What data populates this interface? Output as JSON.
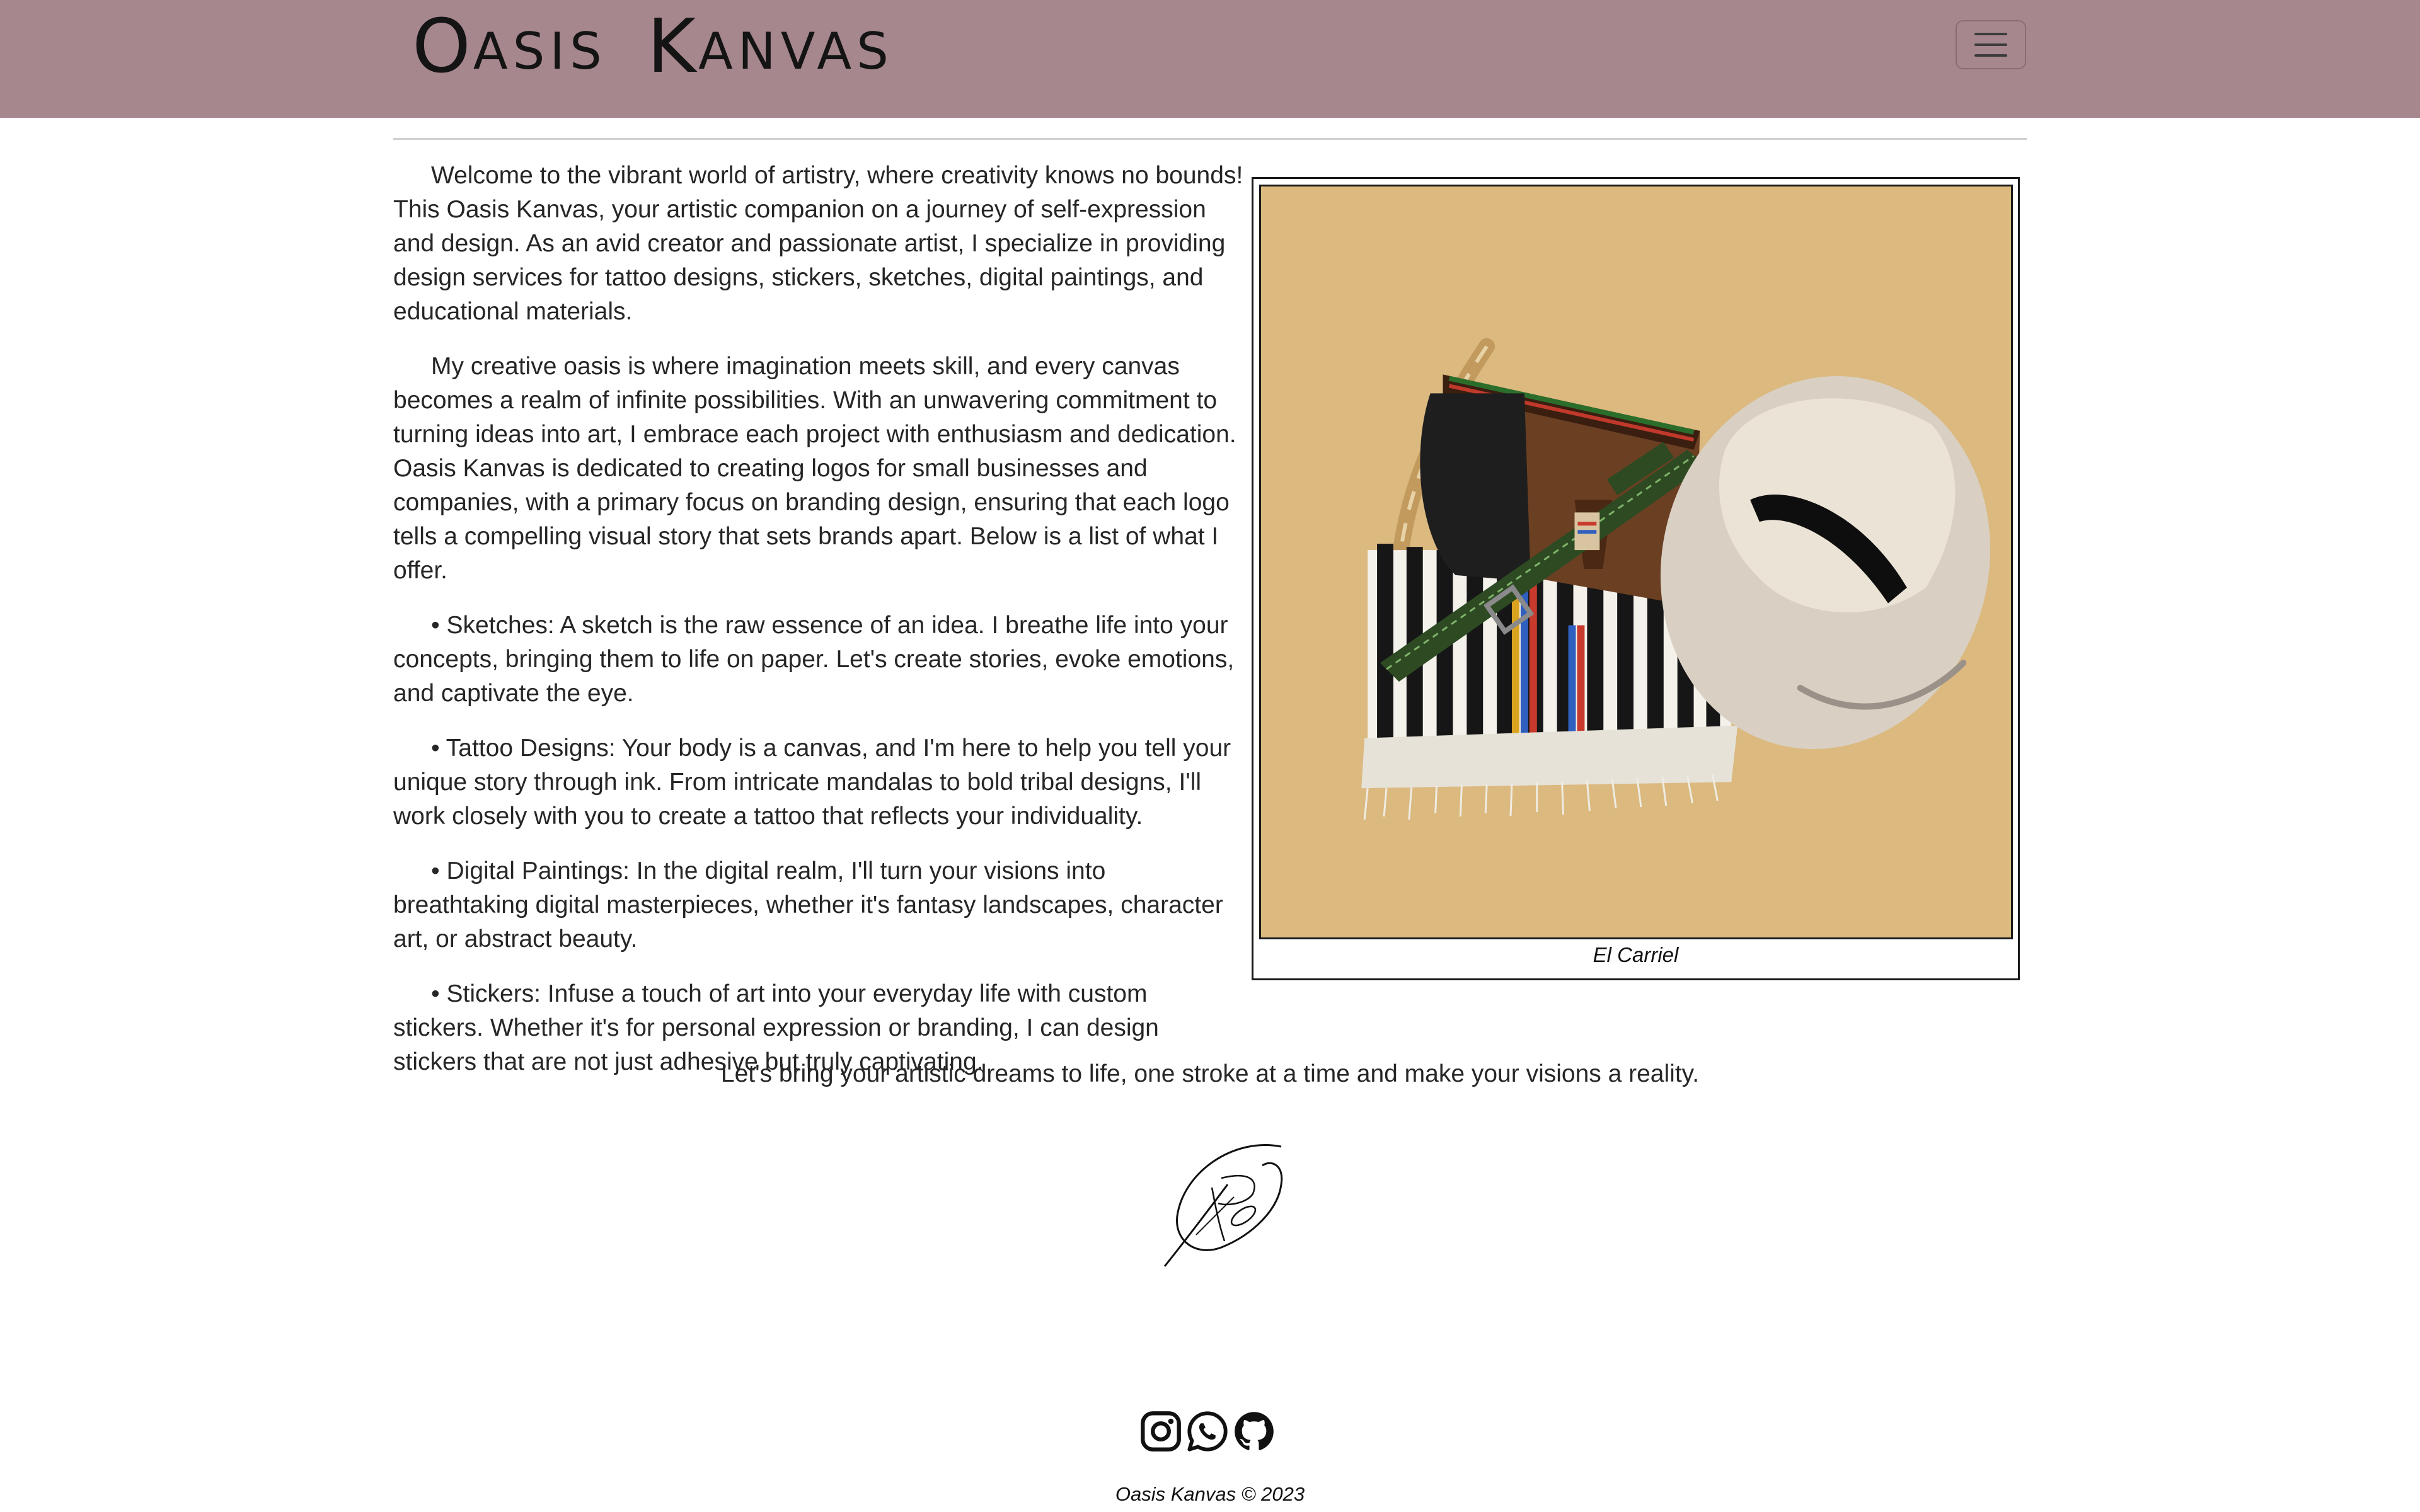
{
  "navbar": {
    "brand": {
      "words": [
        {
          "cap": "O",
          "rest": "ASIS"
        },
        {
          "cap": "K",
          "rest": "ANVAS"
        }
      ]
    },
    "toggler_icon": "hamburger-menu-icon",
    "background": "#a6878d"
  },
  "main": {
    "paragraphs": [
      "Welcome to the vibrant world of artistry, where creativity knows no bounds! This Oasis Kanvas, your artistic companion on a journey of self-expression and design. As an avid creator and passionate artist, I specialize in providing design services for tattoo designs, stickers, sketches, digital paintings, and educational materials.",
      "My creative oasis is where imagination meets skill, and every canvas becomes a realm of infinite possibilities. With an unwavering commitment to turning ideas into art, I embrace each project with enthusiasm and dedication. Oasis Kanvas is dedicated to creating logos for small businesses and companies, with a primary focus on branding design, ensuring that each logo tells a compelling visual story that sets brands apart. Below is a list of what I offer.",
      "• Sketches: A sketch is the raw essence of an idea. I breathe life into your concepts, bringing them to life on paper. Let's create stories, evoke emotions, and captivate the eye.",
      "• Tattoo Designs: Your body is a canvas, and I'm here to help you tell your unique story through ink. From intricate mandalas to bold tribal designs, I'll work closely with you to create a tattoo that reflects your individuality.",
      "• Digital Paintings: In the digital realm, I'll turn your visions into breathtaking digital masterpieces, whether it's fantasy landscapes, character art, or abstract beauty.",
      "• Stickers: Infuse a touch of art into your everyday life with custom stickers. Whether it's for personal expression or branding, I can design stickers that are not just adhesive but truly captivating."
    ],
    "figure": {
      "caption": "El Carriel",
      "background": "#dbb97f"
    },
    "closing": "Let's bring your artistic dreams to life, one stroke at a time and make your visions a reality."
  },
  "footer": {
    "social_icons": [
      "instagram-icon",
      "whatsapp-icon",
      "github-icon"
    ],
    "copyright": "Oasis Kanvas © 2023"
  }
}
